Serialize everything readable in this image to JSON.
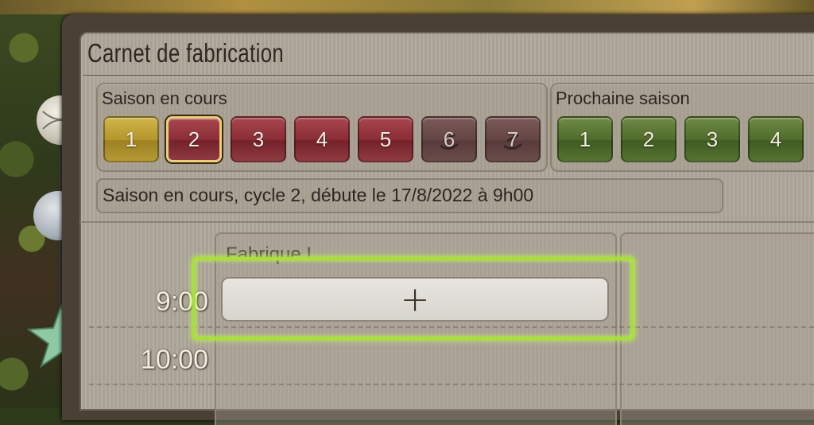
{
  "window": {
    "title": "Carnet de fabrication"
  },
  "current_season": {
    "label": "Saison en cours",
    "cycles": [
      {
        "number": "1",
        "state": "completed"
      },
      {
        "number": "2",
        "state": "selected"
      },
      {
        "number": "3",
        "state": "available"
      },
      {
        "number": "4",
        "state": "available"
      },
      {
        "number": "5",
        "state": "available"
      },
      {
        "number": "6",
        "state": "locked"
      },
      {
        "number": "7",
        "state": "locked"
      }
    ]
  },
  "next_season": {
    "label": "Prochaine saison",
    "cycles": [
      {
        "number": "1"
      },
      {
        "number": "2"
      },
      {
        "number": "3"
      },
      {
        "number": "4"
      }
    ]
  },
  "info_text": "Saison en cours, cycle 2, débute le 17/8/2022 à 9h00",
  "schedule": {
    "column_title": "Fabrique !",
    "times": [
      "9:00",
      "10:00"
    ],
    "add_label": "+"
  },
  "colors": {
    "highlight": "#a6e039",
    "completed": "#c2a43a",
    "active": "#8a2d36",
    "next": "#4f6b2b"
  }
}
